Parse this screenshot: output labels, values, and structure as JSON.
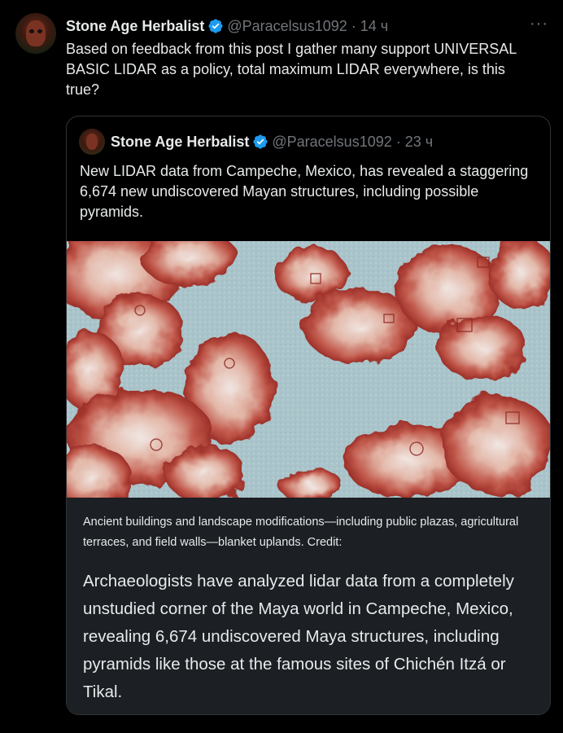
{
  "tweet": {
    "author_name": "Stone Age Herbalist",
    "handle": "@Paracelsus1092",
    "separator": "·",
    "time": "14 ч",
    "more_icon": "more-icon",
    "text": "Based on feedback from this post I gather many support UNIVERSAL BASIC LIDAR as a policy, total maximum LIDAR everywhere, is this true?"
  },
  "quoted": {
    "author_name": "Stone Age Herbalist",
    "handle": "@Paracelsus1092",
    "separator": "·",
    "time": "23 ч",
    "text": "New LIDAR data from Campeche, Mexico, has revealed a staggering 6,674 new undiscovered Mayan structures, including possible pyramids.",
    "image_caption": "Ancient buildings and landscape modifications—including public plazas, agricultural terraces, and field walls—blanket uplands. Credit:",
    "article_text": "Archaeologists have analyzed lidar data from a completely unstudied corner of the Maya world in Campeche, Mexico, revealing 6,674 undiscovered Maya structures, including pyramids like those at the famous sites of Chichén Itzá or Tikal."
  },
  "colors": {
    "background": "#000000",
    "text": "#e7e9ea",
    "muted": "#71767b",
    "verified": "#1d9bf0",
    "card_border": "#2f3336",
    "caption_bg": "#1c1f23"
  }
}
